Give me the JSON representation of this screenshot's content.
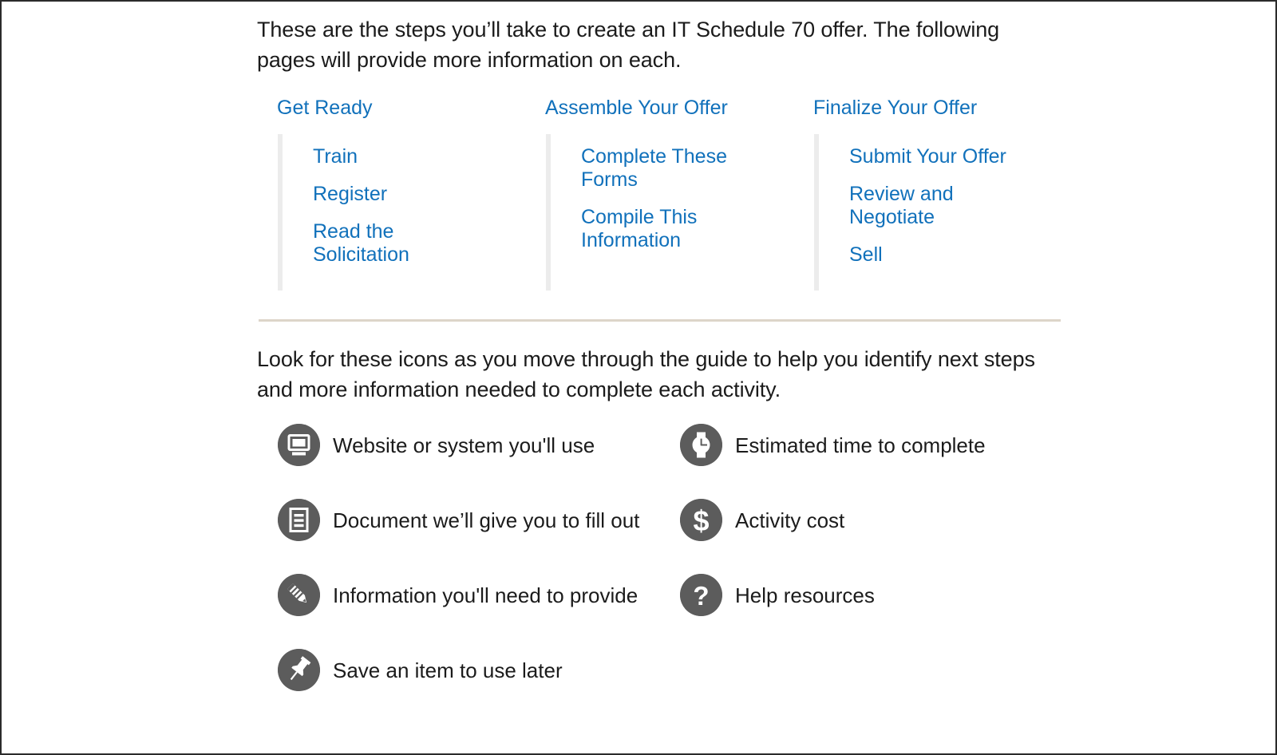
{
  "intro": {
    "paragraph": "These are the steps you’ll take to create an IT Schedule 70 offer. The following pages will provide more information on each."
  },
  "steps": {
    "columns": [
      {
        "heading": "Get Ready",
        "links": [
          "Train",
          "Register",
          "Read the Solicitation"
        ]
      },
      {
        "heading": "Assemble Your Offer",
        "links": [
          "Complete These Forms",
          "Compile This Information"
        ]
      },
      {
        "heading": "Finalize Your Offer",
        "links": [
          "Submit Your Offer",
          "Review and Negotiate",
          "Sell"
        ]
      }
    ]
  },
  "legend": {
    "paragraph": "Look for these icons as you move through the guide to help you identify next steps and more information needed to complete each activity.",
    "items": [
      {
        "icon": "monitor-icon",
        "label": "Website or system you'll use"
      },
      {
        "icon": "document-icon",
        "label": "Document we’ll give you to fill out"
      },
      {
        "icon": "pencil-icon",
        "label": "Information you'll need to provide"
      },
      {
        "icon": "pushpin-icon",
        "label": "Save an item to use later"
      },
      {
        "icon": "watch-icon",
        "label": "Estimated time to complete"
      },
      {
        "icon": "dollar-icon",
        "label": "Activity cost"
      },
      {
        "icon": "question-icon",
        "label": "Help resources"
      }
    ]
  },
  "colors": {
    "link_blue": "#1171bb",
    "body_text": "#1b1b1b",
    "icon_circle": "#5c5c5c",
    "divider": "#ddd5c9",
    "step_rule": "#ececec",
    "page_border": "#2b2b2b"
  }
}
